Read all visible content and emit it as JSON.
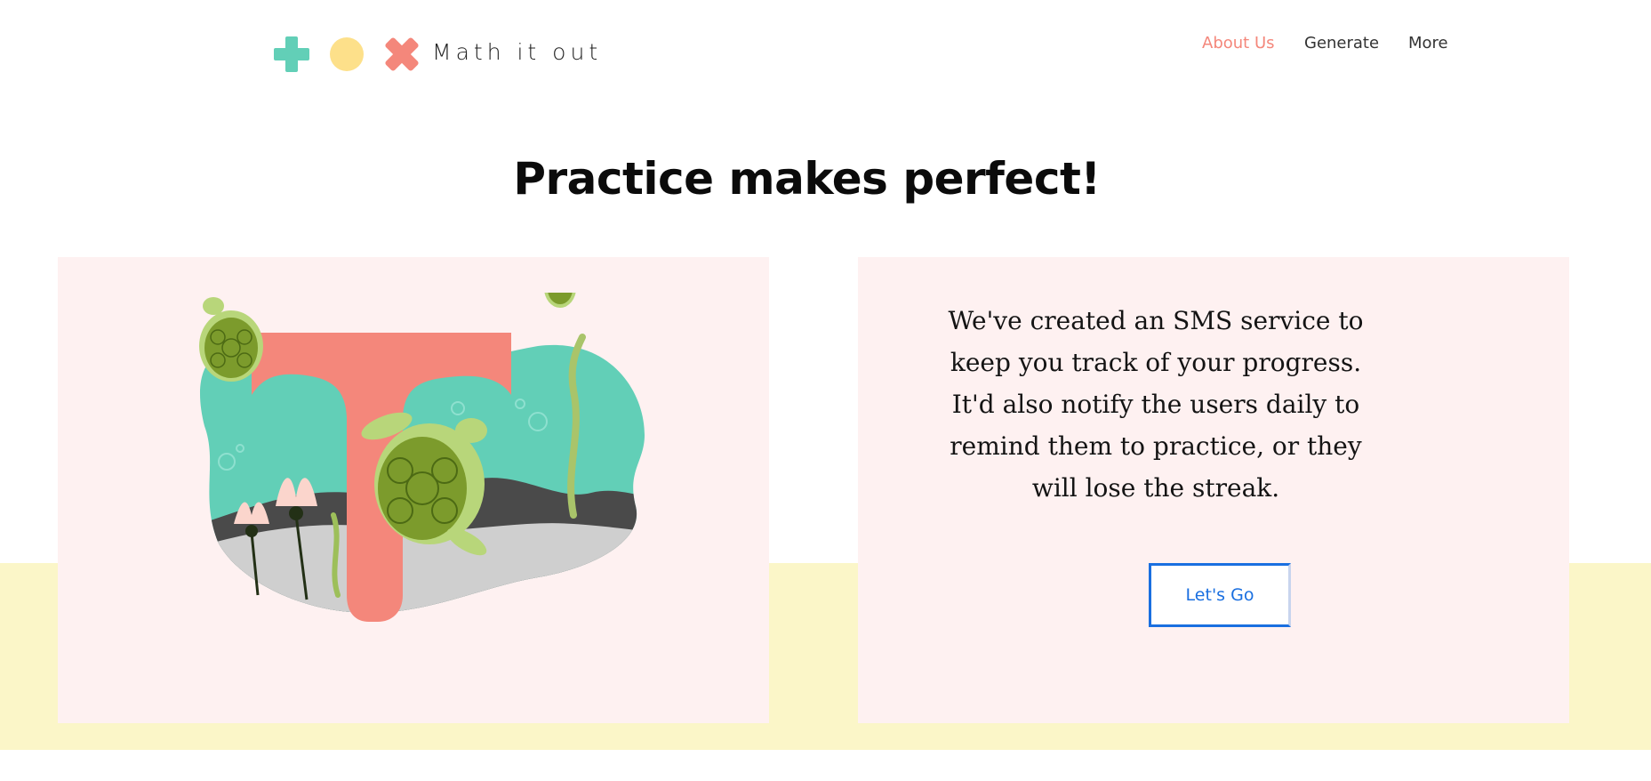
{
  "brand": {
    "name": "Math it out"
  },
  "nav": {
    "items": [
      {
        "label": "About Us"
      },
      {
        "label": "Generate"
      },
      {
        "label": "More"
      }
    ]
  },
  "hero": {
    "headline": "Practice makes perfect!"
  },
  "info": {
    "paragraph": "We've created an SMS service to keep you track of your progress. It'd also notify the users daily to remind them to practice, or they will lose the streak.",
    "cta_label": "Let's Go"
  },
  "colors": {
    "accent_coral": "#f4877b",
    "mint": "#62cfb7",
    "sun_yellow": "#fde08a",
    "panel_pink": "#fef1f1",
    "band_yellow": "#fbf6c8",
    "link_blue": "#1a6fe0"
  },
  "icons": {
    "logo": [
      "plus-icon",
      "circle-icon",
      "times-icon"
    ]
  }
}
